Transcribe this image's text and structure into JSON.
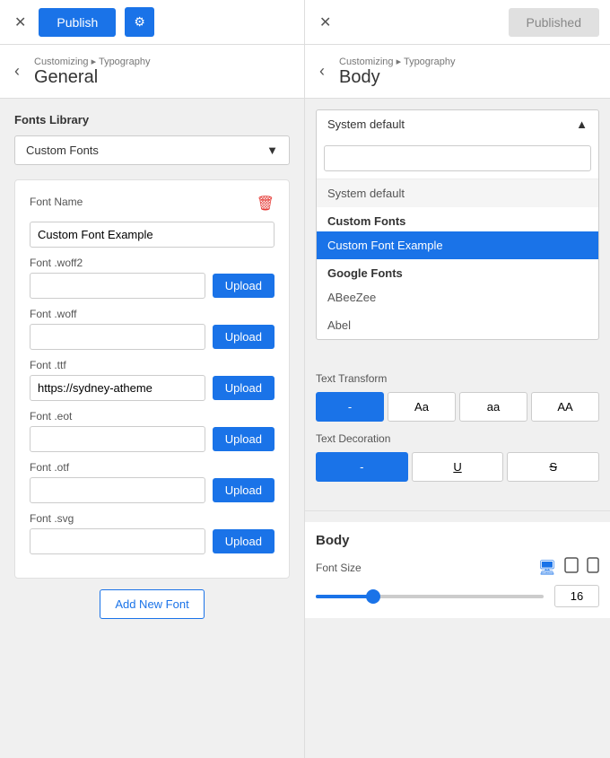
{
  "topbar": {
    "close_left": "✕",
    "publish_label": "Publish",
    "gear_label": "⚙",
    "close_right": "✕",
    "published_label": "Published"
  },
  "nav_left": {
    "back": "‹",
    "breadcrumb": "Customizing ▸ Typography",
    "title": "General"
  },
  "nav_right": {
    "back": "‹",
    "breadcrumb": "Customizing ▸ Typography",
    "title": "Body"
  },
  "left_panel": {
    "fonts_library_label": "Fonts Library",
    "dropdown_value": "Custom Fonts",
    "font_card": {
      "font_name_label": "Font Name",
      "font_name_value": "Custom Font Example",
      "woff2_label": "Font .woff2",
      "woff2_value": "",
      "woff_label": "Font .woff",
      "woff_value": "",
      "ttf_label": "Font .ttf",
      "ttf_value": "https://sydney-atheme",
      "eot_label": "Font .eot",
      "eot_value": "",
      "otf_label": "Font .otf",
      "otf_value": "",
      "svg_label": "Font .svg",
      "svg_value": "",
      "upload_label": "Upload"
    },
    "add_new_font_label": "Add New Font"
  },
  "right_panel": {
    "dropdown_header": "System default",
    "search_placeholder": "",
    "options": [
      {
        "label": "System default",
        "type": "system"
      },
      {
        "label": "Custom Fonts",
        "type": "section-header"
      },
      {
        "label": "Custom Font Example",
        "type": "selected"
      },
      {
        "label": "Google Fonts",
        "type": "section-header"
      },
      {
        "label": "ABeeZee",
        "type": "item"
      },
      {
        "label": "Abel",
        "type": "item"
      }
    ],
    "text_transform_label": "Text Transform",
    "transform_options": [
      "-",
      "Aa",
      "aa",
      "AA"
    ],
    "text_decoration_label": "Text Decoration",
    "decoration_options": [
      "-",
      "U",
      "S"
    ],
    "body_section": {
      "title": "Body",
      "font_size_label": "Font Size",
      "font_size_value": "16",
      "slider_percent": 25
    }
  },
  "icons": {
    "chevron_down": "▼",
    "chevron_up": "▲",
    "trash": "🗑",
    "monitor": "🖥",
    "tablet": "⬜",
    "mobile": "📱"
  }
}
